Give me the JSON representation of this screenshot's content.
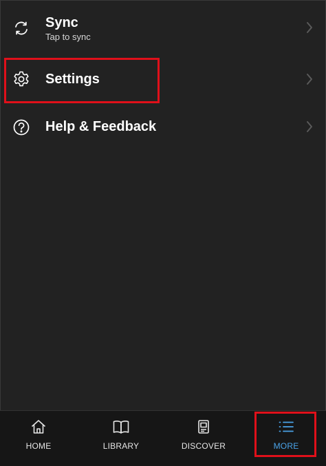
{
  "menu": {
    "sync": {
      "title": "Sync",
      "subtitle": "Tap to sync",
      "icon": "sync-icon"
    },
    "settings": {
      "title": "Settings",
      "icon": "gear-icon"
    },
    "help": {
      "title": "Help & Feedback",
      "icon": "question-circle-icon"
    }
  },
  "tabs": [
    {
      "label": "HOME",
      "icon": "home-icon"
    },
    {
      "label": "LIBRARY",
      "icon": "book-icon"
    },
    {
      "label": "DISCOVER",
      "icon": "discover-icon"
    },
    {
      "label": "MORE",
      "icon": "list-icon",
      "active": true
    }
  ],
  "colors": {
    "background": "#222222",
    "tabbar": "#161616",
    "active_tab": "#4aa3e8",
    "highlight": "#e0101a"
  }
}
